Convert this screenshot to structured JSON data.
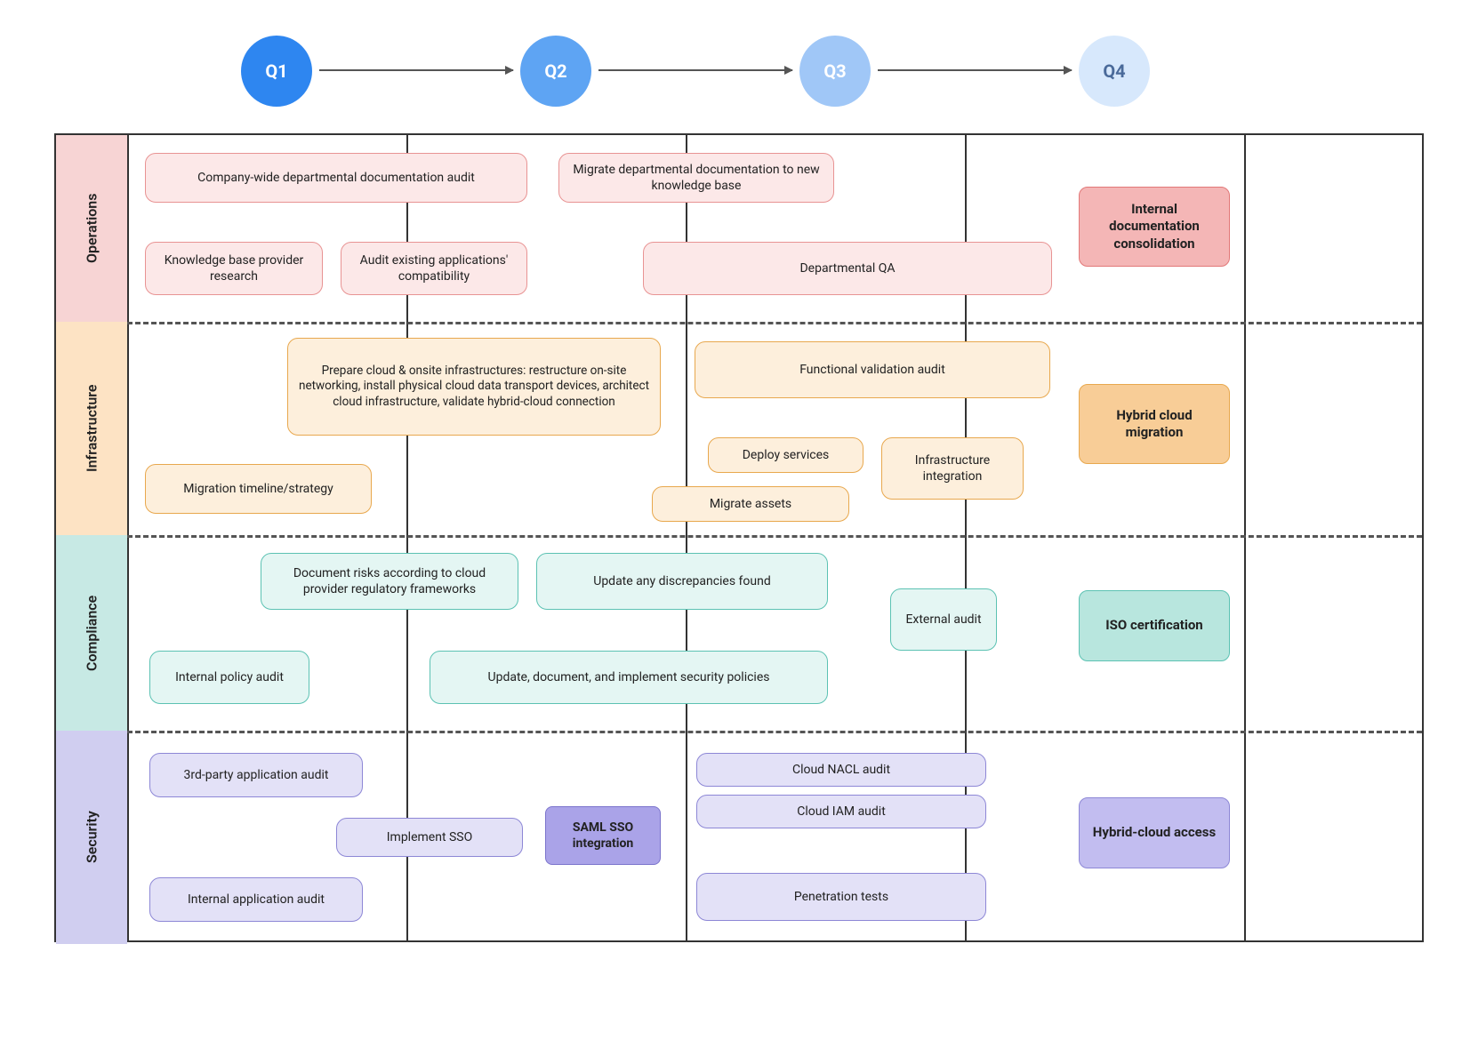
{
  "quarters": {
    "q1": "Q1",
    "q2": "Q2",
    "q3": "Q3",
    "q4": "Q4"
  },
  "lanes": {
    "ops": "Operations",
    "infra": "Infrastructure",
    "comp": "Compliance",
    "sec": "Security"
  },
  "ops": {
    "audit": "Company-wide departmental documentation audit",
    "kb_research": "Knowledge base provider research",
    "app_compat": "Audit existing applications' compatibility",
    "migrate_docs": "Migrate departmental documentation to new knowledge base",
    "dept_qa": "Departmental QA",
    "goal": "Internal documentation consolidation"
  },
  "infra": {
    "prepare": "Prepare cloud & onsite infrastructures: restructure on-site networking, install physical cloud data transport devices, architect cloud infrastructure, validate hybrid-cloud connection",
    "timeline": "Migration timeline/strategy",
    "func_audit": "Functional validation audit",
    "deploy": "Deploy services",
    "infra_int": "Infrastructure integration",
    "migrate_assets": "Migrate assets",
    "goal": "Hybrid cloud migration"
  },
  "comp": {
    "doc_risks": "Document risks according to cloud provider regulatory frameworks",
    "internal_audit": "Internal policy audit",
    "update_disc": "Update any discrepancies found",
    "update_policies": "Update, document, and implement security policies",
    "ext_audit": "External audit",
    "goal": "ISO certification"
  },
  "sec": {
    "third_party": "3rd-party application audit",
    "internal_app": "Internal application audit",
    "impl_sso": "Implement SSO",
    "saml": "SAML SSO integration",
    "nacl": "Cloud NACL audit",
    "iam": "Cloud IAM audit",
    "pentest": "Penetration tests",
    "goal": "Hybrid-cloud access"
  }
}
